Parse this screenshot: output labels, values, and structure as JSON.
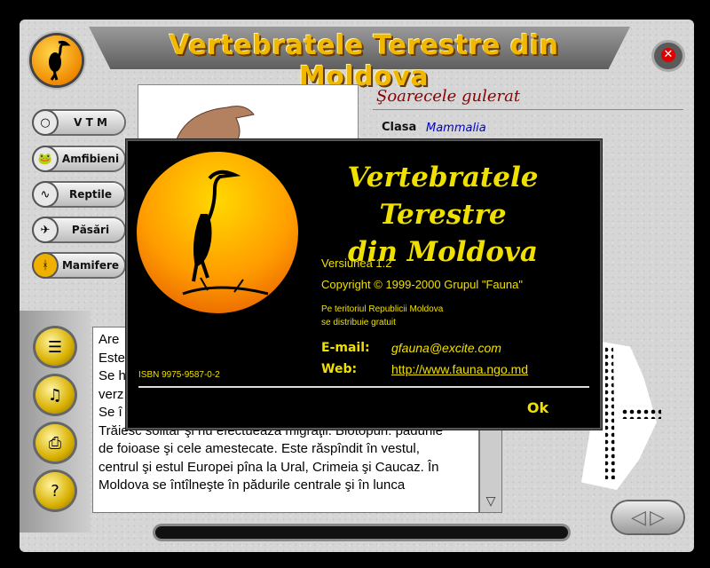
{
  "app": {
    "title": "Vertebratele Terestre din Moldova"
  },
  "nav": {
    "items": [
      {
        "label": "V T M",
        "icon": "circle-icon"
      },
      {
        "label": "Amfibieni",
        "icon": "frog-icon"
      },
      {
        "label": "Reptile",
        "icon": "snake-icon"
      },
      {
        "label": "Păsări",
        "icon": "bird-icon"
      },
      {
        "label": "Mamifere",
        "icon": "deer-icon"
      }
    ],
    "active": "Mamifere"
  },
  "tools": [
    {
      "icon": "search-list-icon"
    },
    {
      "icon": "speaker-icon"
    },
    {
      "icon": "printer-icon"
    },
    {
      "icon": "help-icon"
    }
  ],
  "species": {
    "name": "Şoarecele gulerat",
    "clasa_label": "Clasa",
    "clasa_value": "Mammalia",
    "description": "Are\nEste\nSe h\nverz\nSe î\nTrăiesc solitar şi nu efectuează migraţii. Biotopuri: pădurile\nde foioase şi cele amestecate. Este răspîndit în vestul,\ncentrul şi estul Europei pîna la Ural, Crimeia şi Caucaz. În\nMoldova se întîlneşte în pădurile centrale şi în lunca"
  },
  "about": {
    "title_line1": "Vertebratele Terestre",
    "title_line2": "din Moldova",
    "version": "Versiunea 1.2",
    "copyright": "Copyright © 1999-2000 Grupul \"Fauna\"",
    "territory_line1": "Pe teritoriul Republicii Moldova",
    "territory_line2": "se distribuie gratuit",
    "email_label": "E-mail:",
    "email_value": "gfauna@excite.com",
    "web_label": "Web:",
    "web_value": "http://www.fauna.ngo.md",
    "isbn": "ISBN 9975-9587-0-2",
    "ok_label": "Ok"
  },
  "colors": {
    "accent": "#f0b800",
    "dialog_text": "#f0e000",
    "species_name": "#8b0000"
  }
}
